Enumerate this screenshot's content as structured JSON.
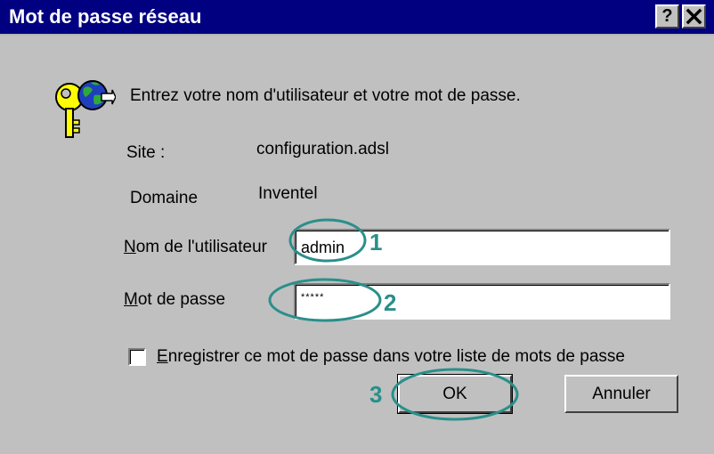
{
  "window": {
    "title": "Mot de passe réseau",
    "help_button": "?",
    "close_button": "✕"
  },
  "prompt": "Entrez votre nom d'utilisateur et votre mot de passe.",
  "site": {
    "label": "Site :",
    "value": "configuration.adsl"
  },
  "domain": {
    "label": "Domaine",
    "value": "Inventel"
  },
  "username": {
    "label_accel": "N",
    "label_rest": "om de l'utilisateur",
    "value": "admin"
  },
  "password": {
    "label_accel": "M",
    "label_rest": "ot de passe",
    "value": "*****"
  },
  "remember": {
    "label_accel": "E",
    "label_rest": "nregistrer ce mot de passe dans votre liste de mots de passe",
    "checked": false
  },
  "buttons": {
    "ok": "OK",
    "cancel": "Annuler"
  },
  "annotations": {
    "step1": "1",
    "step2": "2",
    "step3": "3",
    "color": "#2a8f8a"
  },
  "colors": {
    "titlebar": "#000080",
    "dialog_bg": "#c0c0c0",
    "annotation": "#2a8f8a"
  },
  "icons": {
    "dialog_icon": "key-globe-icon"
  }
}
